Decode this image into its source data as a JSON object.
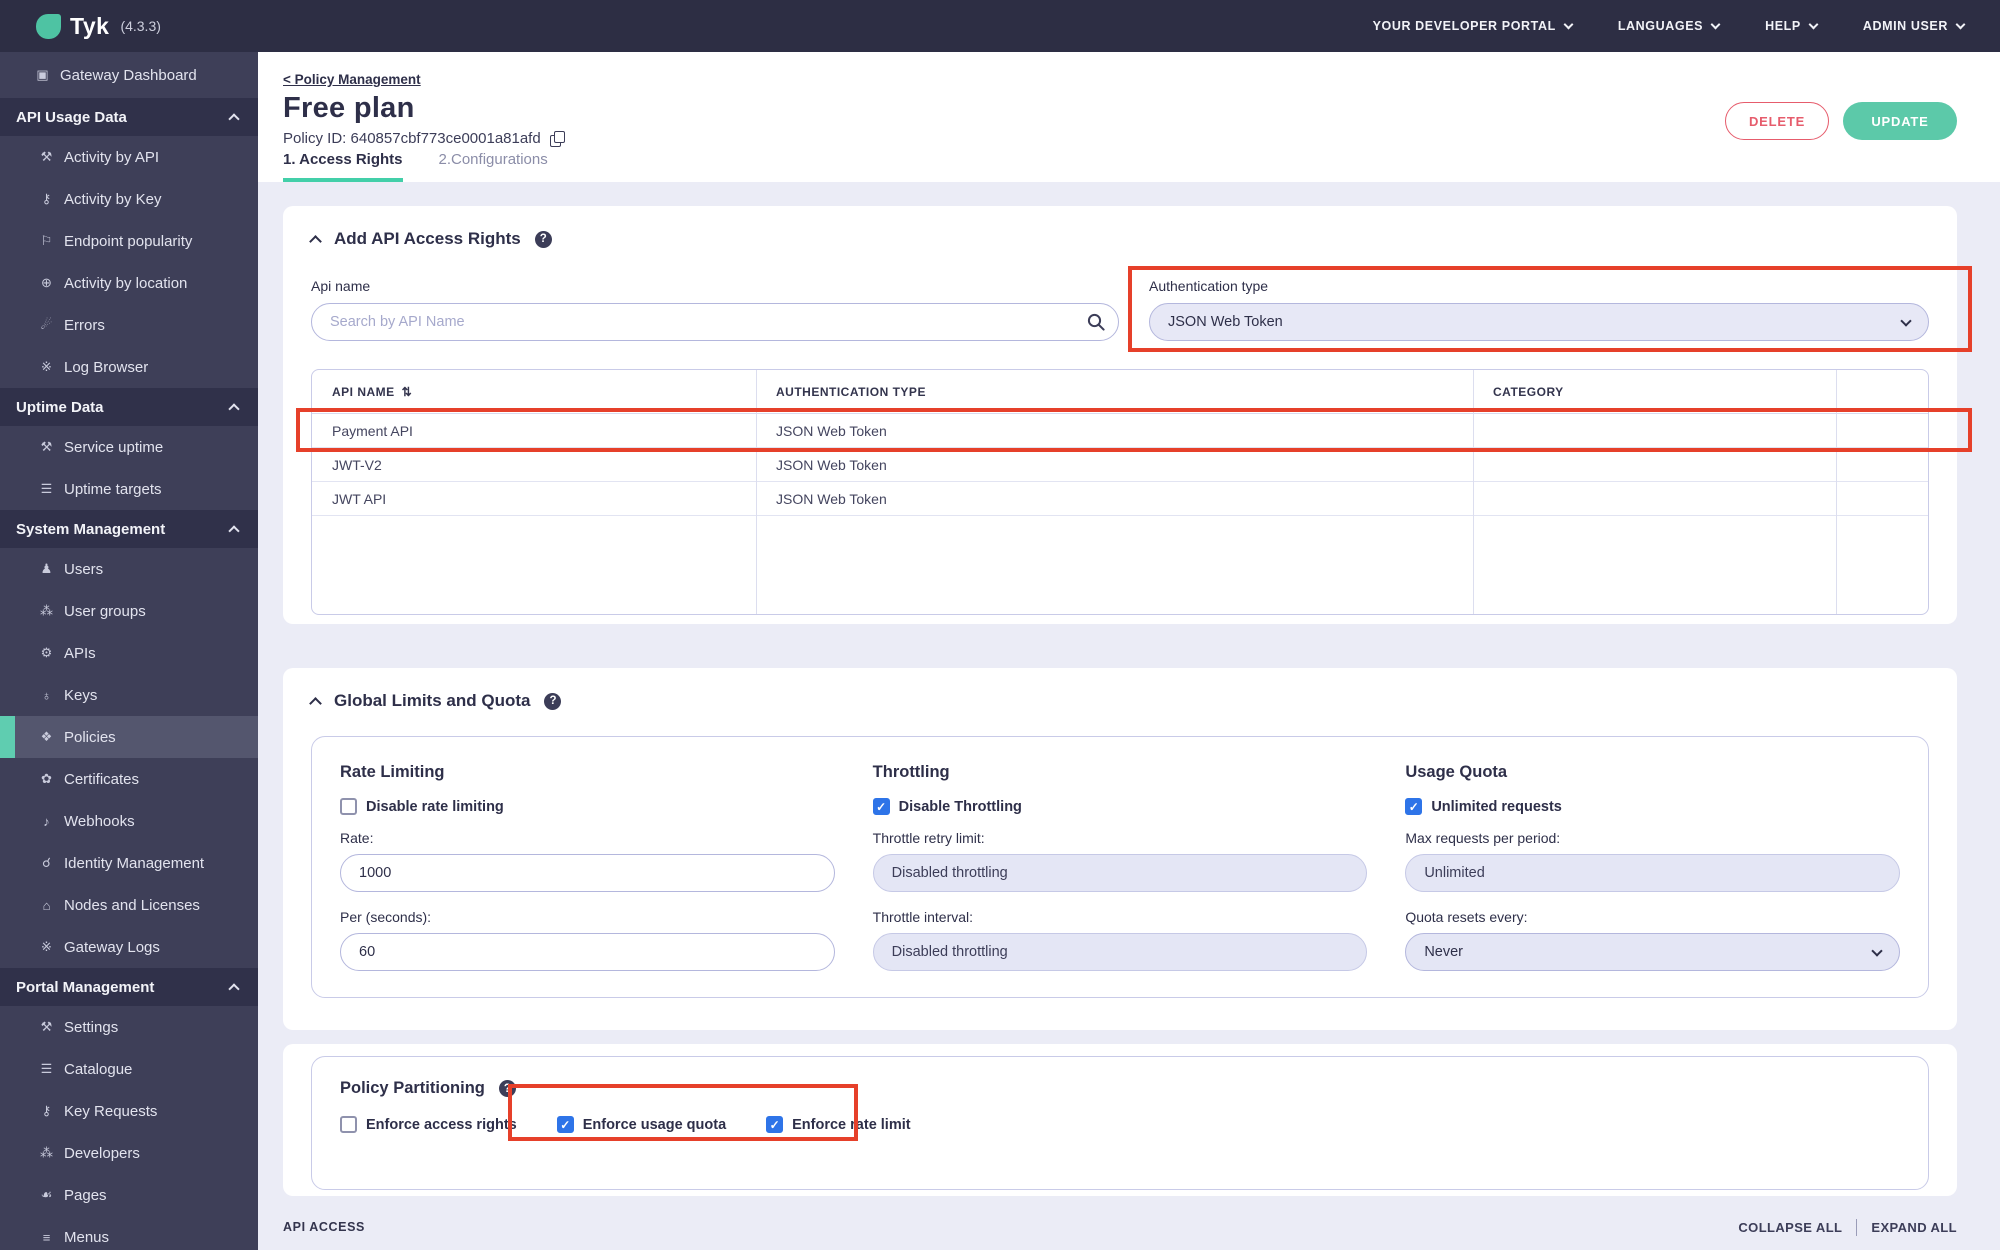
{
  "topbar": {
    "logo_text": "Tyk",
    "version": "(4.3.3)",
    "menus": [
      {
        "label": "YOUR DEVELOPER PORTAL"
      },
      {
        "label": "LANGUAGES"
      },
      {
        "label": "HELP"
      },
      {
        "label": "ADMIN USER"
      }
    ]
  },
  "sidebar": {
    "items": [
      {
        "type": "item",
        "label": "Gateway Dashboard",
        "icon": "monitor-icon",
        "glyph": "▣"
      },
      {
        "type": "section",
        "label": "API Usage Data"
      },
      {
        "type": "item",
        "label": "Activity by API",
        "icon": "wrench-icon",
        "glyph": "⚒"
      },
      {
        "type": "item",
        "label": "Activity by Key",
        "icon": "key-icon",
        "glyph": "⚷"
      },
      {
        "type": "item",
        "label": "Endpoint popularity",
        "icon": "flag-icon",
        "glyph": "⚐"
      },
      {
        "type": "item",
        "label": "Activity by location",
        "icon": "globe-icon",
        "glyph": "⊕"
      },
      {
        "type": "item",
        "label": "Errors",
        "icon": "bomb-icon",
        "glyph": "☄"
      },
      {
        "type": "item",
        "label": "Log Browser",
        "icon": "bug-icon",
        "glyph": "※"
      },
      {
        "type": "section",
        "label": "Uptime Data"
      },
      {
        "type": "item",
        "label": "Service uptime",
        "icon": "wrench-icon",
        "glyph": "⚒"
      },
      {
        "type": "item",
        "label": "Uptime targets",
        "icon": "list-icon",
        "glyph": "☰"
      },
      {
        "type": "section",
        "label": "System Management"
      },
      {
        "type": "item",
        "label": "Users",
        "icon": "user-icon",
        "glyph": "♟"
      },
      {
        "type": "item",
        "label": "User groups",
        "icon": "users-icon",
        "glyph": "⁂"
      },
      {
        "type": "item",
        "label": "APIs",
        "icon": "gears-icon",
        "glyph": "⚙"
      },
      {
        "type": "item",
        "label": "Keys",
        "icon": "network-icon",
        "glyph": "♁"
      },
      {
        "type": "item",
        "label": "Policies",
        "icon": "policy-icon",
        "glyph": "❖",
        "active": true
      },
      {
        "type": "item",
        "label": "Certificates",
        "icon": "certificate-icon",
        "glyph": "✿"
      },
      {
        "type": "item",
        "label": "Webhooks",
        "icon": "bell-icon",
        "glyph": "♪"
      },
      {
        "type": "item",
        "label": "Identity Management",
        "icon": "plug-icon",
        "glyph": "☌"
      },
      {
        "type": "item",
        "label": "Nodes and Licenses",
        "icon": "building-icon",
        "glyph": "⌂"
      },
      {
        "type": "item",
        "label": "Gateway Logs",
        "icon": "bug-icon",
        "glyph": "※"
      },
      {
        "type": "section",
        "label": "Portal Management"
      },
      {
        "type": "item",
        "label": "Settings",
        "icon": "wrench-icon",
        "glyph": "⚒"
      },
      {
        "type": "item",
        "label": "Catalogue",
        "icon": "list-icon",
        "glyph": "☰"
      },
      {
        "type": "item",
        "label": "Key Requests",
        "icon": "key-icon",
        "glyph": "⚷"
      },
      {
        "type": "item",
        "label": "Developers",
        "icon": "users-icon",
        "glyph": "⁂"
      },
      {
        "type": "item",
        "label": "Pages",
        "icon": "leaf-icon",
        "glyph": "☙"
      },
      {
        "type": "item",
        "label": "Menus",
        "icon": "menu-icon",
        "glyph": "≡"
      }
    ]
  },
  "page": {
    "breadcrumb": "< Policy Management",
    "title": "Free plan",
    "policy_id": "Policy ID: 640857cbf773ce0001a81afd",
    "tabs": [
      {
        "label": "1. Access Rights",
        "active": true
      },
      {
        "label": "2.Configurations",
        "active": false
      }
    ],
    "delete_button": "DELETE",
    "update_button": "UPDATE"
  },
  "access_rights": {
    "section_title": "Add API Access Rights",
    "api_name_label": "Api name",
    "search_placeholder": "Search by API Name",
    "auth_type_label": "Authentication type",
    "auth_type_value": "JSON Web Token",
    "table": {
      "sort_icon": "⇅",
      "columns": [
        "API NAME",
        "AUTHENTICATION TYPE",
        "CATEGORY"
      ],
      "rows": [
        {
          "api_name": "Payment API",
          "auth_type": "JSON Web Token",
          "category": ""
        },
        {
          "api_name": "JWT-V2",
          "auth_type": "JSON Web Token",
          "category": ""
        },
        {
          "api_name": "JWT API",
          "auth_type": "JSON Web Token",
          "category": ""
        }
      ]
    }
  },
  "global_limits": {
    "section_title": "Global Limits and Quota",
    "rate_limiting": {
      "title": "Rate Limiting",
      "checkbox_label": "Disable rate limiting",
      "checkbox_checked": false,
      "rate_label": "Rate:",
      "rate_value": "1000",
      "per_label": "Per (seconds):",
      "per_value": "60"
    },
    "throttling": {
      "title": "Throttling",
      "checkbox_label": "Disable Throttling",
      "checkbox_checked": true,
      "retry_label": "Throttle retry limit:",
      "retry_value": "Disabled throttling",
      "interval_label": "Throttle interval:",
      "interval_value": "Disabled throttling"
    },
    "usage_quota": {
      "title": "Usage Quota",
      "checkbox_label": "Unlimited requests",
      "checkbox_checked": true,
      "max_label": "Max requests per period:",
      "max_value": "Unlimited",
      "resets_label": "Quota resets every:",
      "resets_value": "Never"
    }
  },
  "policy_partitioning": {
    "title": "Policy Partitioning",
    "checkboxes": [
      {
        "label": "Enforce access rights",
        "checked": false
      },
      {
        "label": "Enforce usage quota",
        "checked": true
      },
      {
        "label": "Enforce rate limit",
        "checked": true
      }
    ]
  },
  "footer": {
    "section_label": "API ACCESS",
    "collapse_all": "COLLAPSE ALL",
    "expand_all": "EXPAND ALL"
  },
  "colors": {
    "accent_teal": "#52c9a8",
    "danger_red": "#e65c6c",
    "annotation_red": "#e6402a",
    "checkbox_blue": "#2e74e8",
    "topbar_bg": "#2d2e44",
    "sidebar_bg": "#3e3f58"
  }
}
